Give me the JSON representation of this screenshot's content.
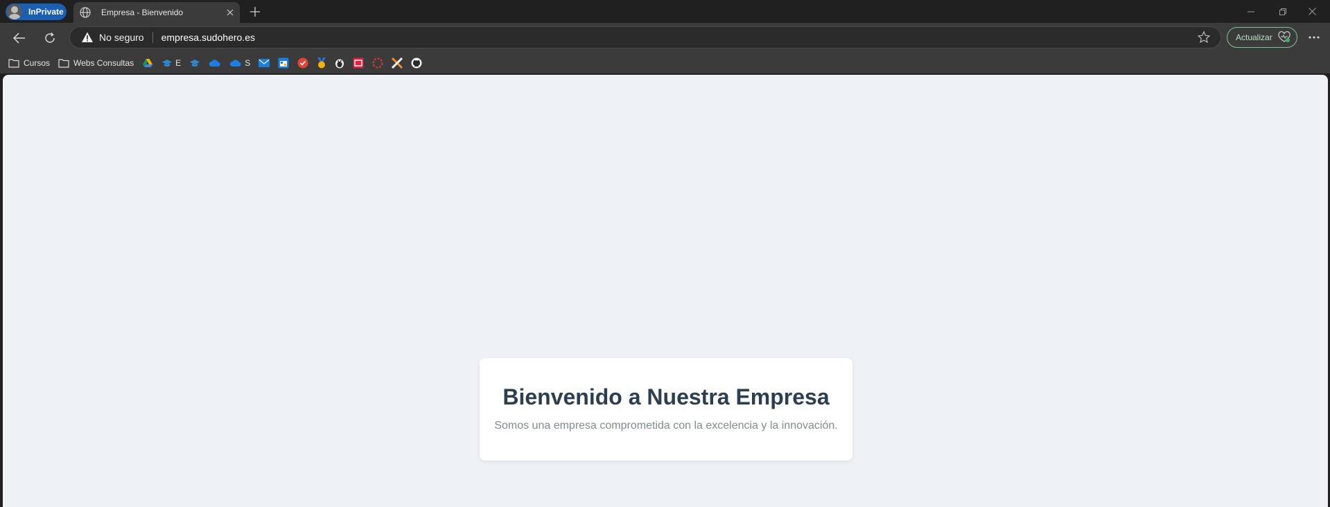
{
  "browser": {
    "inprivate_label": "InPrivate",
    "tab": {
      "title": "Empresa - Bienvenido"
    },
    "address_bar": {
      "security_label": "No seguro",
      "url": "empresa.sudohero.es"
    },
    "update_button_label": "Actualizar",
    "bookmarks": [
      {
        "type": "folder",
        "label": "Cursos"
      },
      {
        "type": "folder",
        "label": "Webs Consultas"
      },
      {
        "type": "icon",
        "icon": "google-drive-icon",
        "label": ""
      },
      {
        "type": "icon",
        "icon": "graduation-cap-icon",
        "label": "E"
      },
      {
        "type": "icon",
        "icon": "graduation-cap-icon",
        "label": ""
      },
      {
        "type": "icon",
        "icon": "onedrive-cloud-icon",
        "label": ""
      },
      {
        "type": "icon",
        "icon": "onedrive-cloud-icon",
        "label": "S"
      },
      {
        "type": "icon",
        "icon": "mail-icon",
        "label": ""
      },
      {
        "type": "icon",
        "icon": "calendar-icon",
        "label": ""
      },
      {
        "type": "icon",
        "icon": "todoist-check-icon",
        "label": ""
      },
      {
        "type": "icon",
        "icon": "medal-icon",
        "label": ""
      },
      {
        "type": "icon",
        "icon": "linux-penguin-icon",
        "label": ""
      },
      {
        "type": "icon",
        "icon": "red-square-app-icon",
        "label": ""
      },
      {
        "type": "icon",
        "icon": "red-dashed-circle-icon",
        "label": ""
      },
      {
        "type": "icon",
        "icon": "x-logo-icon",
        "label": ""
      },
      {
        "type": "icon",
        "icon": "github-icon",
        "label": ""
      }
    ]
  },
  "page": {
    "heading": "Bienvenido a Nuestra Empresa",
    "tagline": "Somos una empresa comprometida con la excelencia y la innovación."
  },
  "colors": {
    "page_background": "#eef1f6",
    "heading": "#2c3e50",
    "tagline": "#7f8c8d",
    "inprivate": "#1a5fb4"
  }
}
